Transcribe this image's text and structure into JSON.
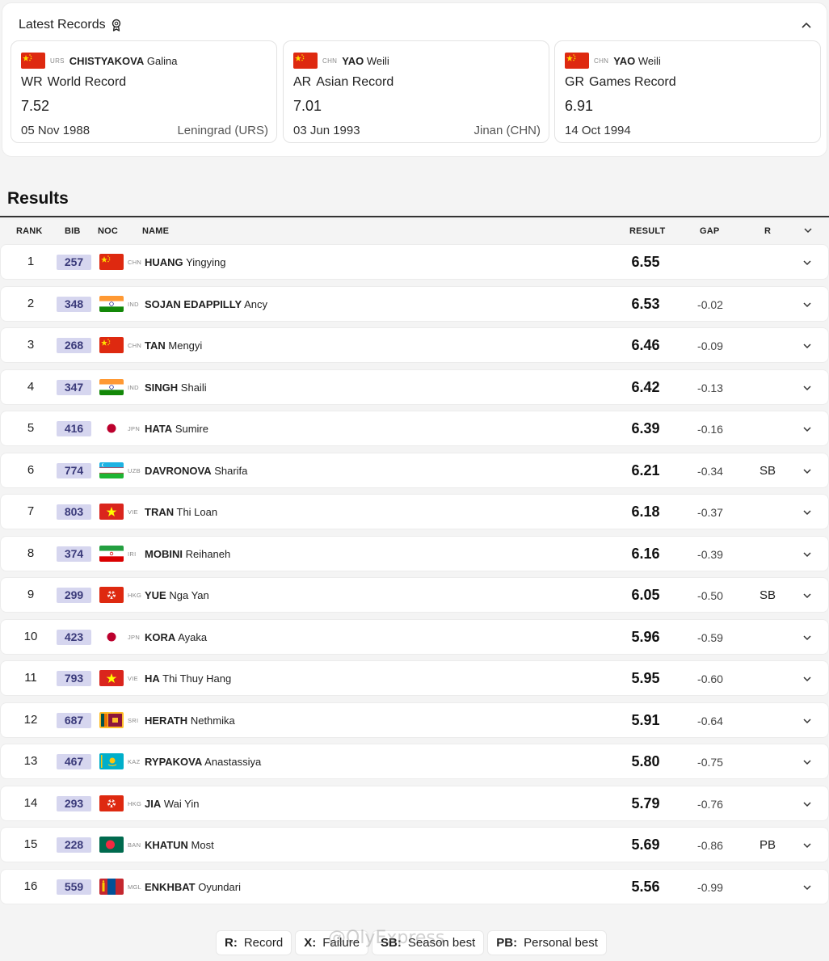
{
  "records": {
    "title": "Latest Records",
    "cards": [
      {
        "noc": "URS",
        "flag": "chn",
        "surname": "CHISTYAKOVA",
        "given": "Galina",
        "abbr": "WR",
        "type": "World Record",
        "value": "7.52",
        "date": "05 Nov 1988",
        "place": "Leningrad (URS)"
      },
      {
        "noc": "CHN",
        "flag": "chn",
        "surname": "YAO",
        "given": "Weili",
        "abbr": "AR",
        "type": "Asian Record",
        "value": "7.01",
        "date": "03 Jun 1993",
        "place": "Jinan (CHN)"
      },
      {
        "noc": "CHN",
        "flag": "chn",
        "surname": "YAO",
        "given": "Weili",
        "abbr": "GR",
        "type": "Games Record",
        "value": "6.91",
        "date": "14 Oct 1994",
        "place": ""
      }
    ]
  },
  "results": {
    "title": "Results",
    "headers": {
      "rank": "RANK",
      "bib": "BIB",
      "noc": "NOC",
      "name": "NAME",
      "result": "RESULT",
      "gap": "GAP",
      "record": "R"
    },
    "rows": [
      {
        "rank": "1",
        "bib": "257",
        "noc": "CHN",
        "flag": "chn",
        "surname": "HUANG",
        "given": "Yingying",
        "result": "6.55",
        "gap": "",
        "record": ""
      },
      {
        "rank": "2",
        "bib": "348",
        "noc": "IND",
        "flag": "ind",
        "surname": "SOJAN EDAPPILLY",
        "given": "Ancy",
        "result": "6.53",
        "gap": "-0.02",
        "record": ""
      },
      {
        "rank": "3",
        "bib": "268",
        "noc": "CHN",
        "flag": "chn",
        "surname": "TAN",
        "given": "Mengyi",
        "result": "6.46",
        "gap": "-0.09",
        "record": ""
      },
      {
        "rank": "4",
        "bib": "347",
        "noc": "IND",
        "flag": "ind",
        "surname": "SINGH",
        "given": "Shaili",
        "result": "6.42",
        "gap": "-0.13",
        "record": ""
      },
      {
        "rank": "5",
        "bib": "416",
        "noc": "JPN",
        "flag": "jpn",
        "surname": "HATA",
        "given": "Sumire",
        "result": "6.39",
        "gap": "-0.16",
        "record": ""
      },
      {
        "rank": "6",
        "bib": "774",
        "noc": "UZB",
        "flag": "uzb",
        "surname": "DAVRONOVA",
        "given": "Sharifa",
        "result": "6.21",
        "gap": "-0.34",
        "record": "SB"
      },
      {
        "rank": "7",
        "bib": "803",
        "noc": "VIE",
        "flag": "vie",
        "surname": "TRAN",
        "given": "Thi Loan",
        "result": "6.18",
        "gap": "-0.37",
        "record": ""
      },
      {
        "rank": "8",
        "bib": "374",
        "noc": "IRI",
        "flag": "iri",
        "surname": "MOBINI",
        "given": "Reihaneh",
        "result": "6.16",
        "gap": "-0.39",
        "record": ""
      },
      {
        "rank": "9",
        "bib": "299",
        "noc": "HKG",
        "flag": "hkg",
        "surname": "YUE",
        "given": "Nga Yan",
        "result": "6.05",
        "gap": "-0.50",
        "record": "SB"
      },
      {
        "rank": "10",
        "bib": "423",
        "noc": "JPN",
        "flag": "jpn",
        "surname": "KORA",
        "given": "Ayaka",
        "result": "5.96",
        "gap": "-0.59",
        "record": ""
      },
      {
        "rank": "11",
        "bib": "793",
        "noc": "VIE",
        "flag": "vie",
        "surname": "HA",
        "given": "Thi Thuy Hang",
        "result": "5.95",
        "gap": "-0.60",
        "record": ""
      },
      {
        "rank": "12",
        "bib": "687",
        "noc": "SRI",
        "flag": "sri",
        "surname": "HERATH",
        "given": "Nethmika",
        "result": "5.91",
        "gap": "-0.64",
        "record": ""
      },
      {
        "rank": "13",
        "bib": "467",
        "noc": "KAZ",
        "flag": "kaz",
        "surname": "RYPAKOVA",
        "given": "Anastassiya",
        "result": "5.80",
        "gap": "-0.75",
        "record": ""
      },
      {
        "rank": "14",
        "bib": "293",
        "noc": "HKG",
        "flag": "hkg",
        "surname": "JIA",
        "given": "Wai Yin",
        "result": "5.79",
        "gap": "-0.76",
        "record": ""
      },
      {
        "rank": "15",
        "bib": "228",
        "noc": "BAN",
        "flag": "ban",
        "surname": "KHATUN",
        "given": "Most",
        "result": "5.69",
        "gap": "-0.86",
        "record": "PB"
      },
      {
        "rank": "16",
        "bib": "559",
        "noc": "MGL",
        "flag": "mgl",
        "surname": "ENKHBAT",
        "given": "Oyundari",
        "result": "5.56",
        "gap": "-0.99",
        "record": ""
      }
    ]
  },
  "legend": [
    {
      "key": "R:",
      "label": "Record"
    },
    {
      "key": "X:",
      "label": "Failure"
    },
    {
      "key": "SB:",
      "label": "Season best"
    },
    {
      "key": "PB:",
      "label": "Personal best"
    }
  ],
  "watermark": "@OlyExpress",
  "colors": {
    "bib_bg": "#d6d6ef",
    "bib_text": "#3a3a7a",
    "row_bg": "#ffffff",
    "page_bg": "#f4f4f4"
  }
}
